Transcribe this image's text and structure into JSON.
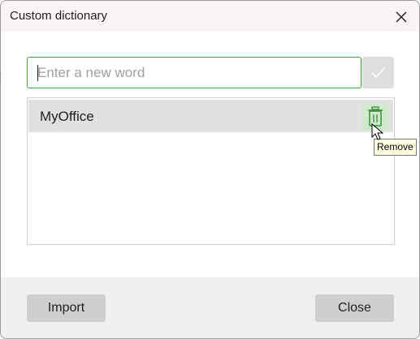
{
  "dialog": {
    "title": "Custom dictionary"
  },
  "new_word": {
    "placeholder": "Enter a new word",
    "value": ""
  },
  "words": [
    {
      "label": "MyOffice"
    }
  ],
  "tooltip": {
    "text": "Remove"
  },
  "footer": {
    "import_label": "Import",
    "close_label": "Close"
  },
  "icons": {
    "close": "close-icon",
    "confirm": "checkmark-icon",
    "remove": "trash-icon",
    "pointer": "mouse-pointer-icon"
  },
  "colors": {
    "accent_border": "#3aa33a",
    "remove_hover_bg": "#cdeacb",
    "selected_row_bg": "#e1e1e1",
    "button_bg": "#cfcfcf",
    "tooltip_bg": "#ffffe1"
  }
}
